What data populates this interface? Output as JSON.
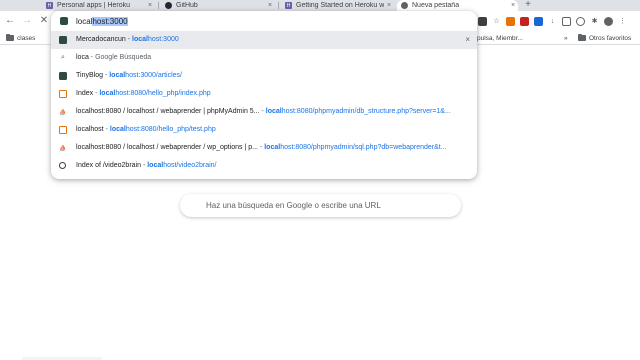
{
  "tabs": [
    {
      "title": "Personal apps | Heroku",
      "close": "×",
      "favicon": "heroku-icon",
      "color": "#6762a6"
    },
    {
      "title": "GitHub",
      "close": "×",
      "favicon": "github-icon",
      "color": "#24292f"
    },
    {
      "title": "Getting Started on Heroku with...",
      "close": "×",
      "favicon": "heroku-icon",
      "color": "#6762a6"
    },
    {
      "title": "Nueva pestaña",
      "close": "×",
      "favicon": "chrome-icon",
      "color": "#5f6368"
    }
  ],
  "new_tab": "+",
  "nav": {
    "back": "←",
    "forward": "→",
    "stop": "✕"
  },
  "omnibox": {
    "typed": "local",
    "completion": "host:3000"
  },
  "suggestions": [
    {
      "pre": "Mercadocancun",
      "sep": " - ",
      "url_match": "local",
      "url_rest": "host:3000",
      "icon": "site-favicon-icon",
      "remove": "×"
    },
    {
      "pre": "loca",
      "sep": " - ",
      "hint": "Google Búsqueda",
      "icon": "search-icon"
    },
    {
      "pre": "TinyBlog",
      "sep": " - ",
      "url_match": "local",
      "url_rest": "host:3000/articles/",
      "icon": "site-favicon-icon"
    },
    {
      "pre": "Index",
      "sep": " - ",
      "url_match": "local",
      "url_rest": "host:8080/hello_php/index.php",
      "icon": "page-icon"
    },
    {
      "pre": "localhost:8080 / localhost / webaprender | phpMyAdmin 5...",
      "sep": " - ",
      "url_match": "local",
      "url_rest": "host:8080/phpmyadmin/db_structure.php?server=1&...",
      "icon": "phpmyadmin-icon"
    },
    {
      "pre": "localhost",
      "sep": " - ",
      "url_match": "local",
      "url_rest": "host:8080/hello_php/test.php",
      "icon": "page-icon"
    },
    {
      "pre": "localhost:8080 / localhost / webaprender / wp_options | p...",
      "sep": " - ",
      "url_match": "local",
      "url_rest": "host:8080/phpmyadmin/sql.php?db=webaprender&t...",
      "icon": "phpmyadmin-icon"
    },
    {
      "pre": "Index of /video2brain",
      "sep": " - ",
      "url_match": "local",
      "url_rest": "host/video2brain/",
      "icon": "globe-icon"
    }
  ],
  "extensions": [
    "extension-icon",
    "bookmark-icon",
    "extension-icon",
    "extension-icon",
    "extension-icon",
    "download-icon",
    "extension-icon",
    "extension-icon",
    "puzzle-icon",
    "avatar",
    "menu-icon"
  ],
  "bookmarks": {
    "clases": "clases",
    "mid": "pulsa, Miembr...",
    "more": "»",
    "others": "Otros favoritos"
  },
  "ntp": {
    "search_placeholder": "Haz una búsqueda en Google o escribe una URL"
  },
  "colors": {
    "accent": "#1a73e8",
    "selection": "#a8c7fa"
  }
}
